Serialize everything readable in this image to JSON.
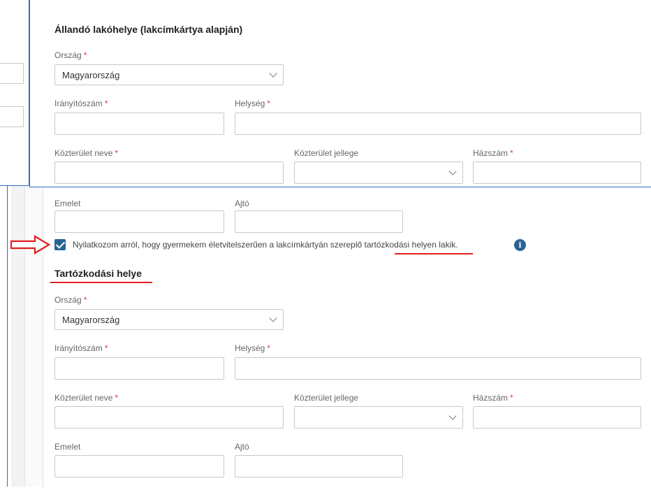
{
  "section1": {
    "title": "Állandó lakóhelye (lakcímkártya alapján)",
    "orszag_label": "Ország",
    "orszag_value": "Magyarország",
    "iranyitoszam_label": "Irányítószám",
    "helyseg_label": "Helység",
    "kozterulet_neve_label": "Közterület neve",
    "kozterulet_jellege_label": "Közterület jellege",
    "hazszam_label": "Házszám",
    "emelet_label": "Emelet",
    "ajto_label": "Ajtó"
  },
  "declaration": {
    "text_before": "Nyilatkozom arról, hogy gyermekem életvitelszerűen a lakcímkártyán szereplő ",
    "text_highlight": "tartózkodási helyen",
    "text_after": " lakik.",
    "checked": true,
    "info_symbol": "i"
  },
  "section2": {
    "title": "Tartózkodási helye",
    "orszag_label": "Ország",
    "orszag_value": "Magyarország",
    "iranyitoszam_label": "Irányítószám",
    "helyseg_label": "Helység",
    "kozterulet_neve_label": "Közterület neve",
    "kozterulet_jellege_label": "Közterület jellege",
    "hazszam_label": "Házszám",
    "emelet_label": "Emelet",
    "ajto_label": "Ajtó"
  },
  "required_mark": "*",
  "colors": {
    "accent": "#2a6496",
    "frame": "#2f6ec8",
    "annotation_red": "#e02020",
    "required": "#e0384a"
  },
  "icons": [
    "chevron-down-icon",
    "info-icon",
    "checkmark-icon",
    "red-arrow-icon"
  ]
}
